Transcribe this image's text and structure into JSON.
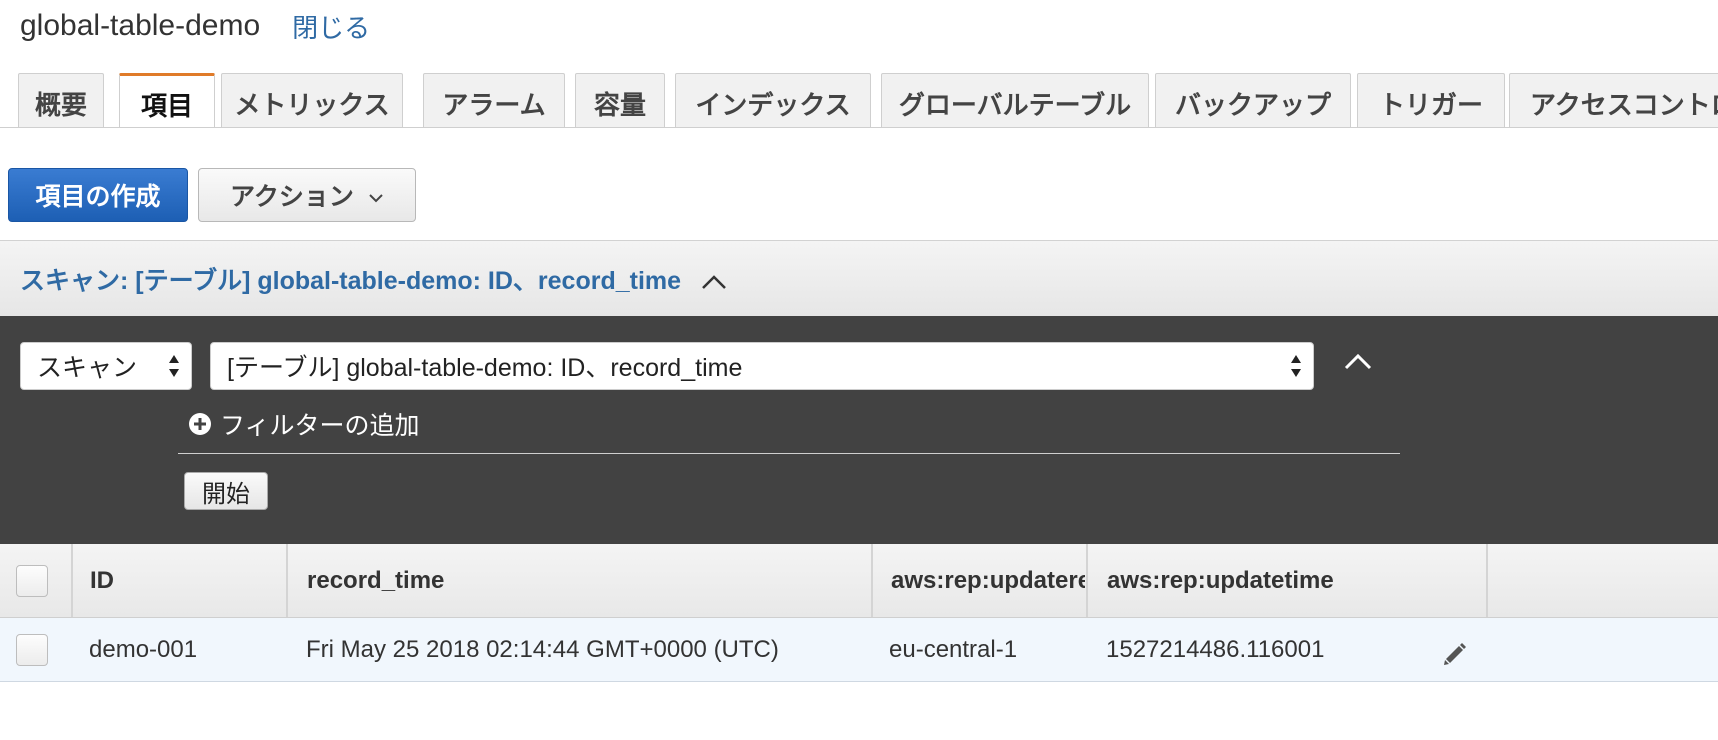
{
  "header": {
    "title": "global-table-demo",
    "close_label": "閉じる"
  },
  "tabs": [
    {
      "label": "概要"
    },
    {
      "label": "項目",
      "active": true
    },
    {
      "label": "メトリックス"
    },
    {
      "label": "アラーム"
    },
    {
      "label": "容量"
    },
    {
      "label": "インデックス"
    },
    {
      "label": "グローバルテーブル"
    },
    {
      "label": "バックアップ"
    },
    {
      "label": "トリガー"
    },
    {
      "label": "アクセスコントロ"
    }
  ],
  "toolbar": {
    "create_label": "項目の作成",
    "action_label": "アクション"
  },
  "scan": {
    "banner_title": "スキャン: [テーブル] global-table-demo: ID、record_time",
    "mode_value": "スキャン",
    "target_value": "[テーブル] global-table-demo: ID、record_time",
    "add_filter_label": "フィルターの追加",
    "start_label": "開始"
  },
  "table": {
    "columns": [
      "ID",
      "record_time",
      "aws:rep:updatere",
      "aws:rep:updatetime"
    ],
    "rows": [
      [
        "demo-001",
        "Fri May 25 2018 02:14:44 GMT+0000 (UTC)",
        "eu-central-1",
        "1527214486.116001"
      ]
    ]
  },
  "colors": {
    "accent": "#2f6aa4",
    "primary_button": "#2266c0",
    "active_tab": "#e07b29",
    "panel_bg": "#424242"
  }
}
